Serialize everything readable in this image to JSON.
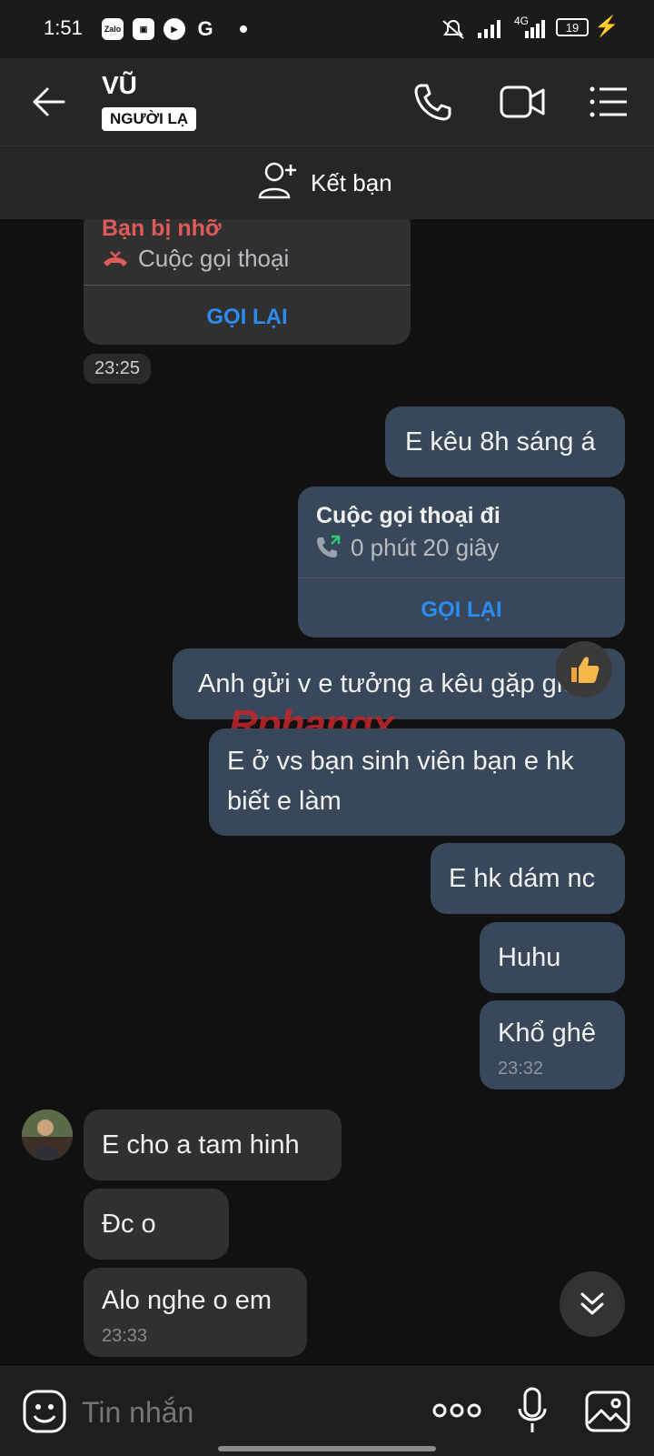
{
  "status_bar": {
    "time": "1:51",
    "app_icons": [
      "zalo-icon",
      "media-icon",
      "youtube-icon",
      "google-icon"
    ],
    "network": "4G",
    "battery": "19"
  },
  "header": {
    "name": "VŨ",
    "badge": "NGƯỜI LẠ"
  },
  "friend_bar": {
    "label": "Kết bạn"
  },
  "messages": {
    "missed_call": {
      "title": "Bạn bị nhỡ",
      "subtitle": "Cuộc gọi thoại",
      "action": "GỌI LẠI",
      "time": "23:25"
    },
    "out1": "E kêu 8h sáng á",
    "outgoing_call": {
      "title": "Cuộc gọi thoại đi",
      "duration": "0 phút 20 giây",
      "action": "GỌI LẠI"
    },
    "out2": "Anh gửi v e tưởng a kêu gặp giờ",
    "out3": "E ở vs bạn sinh viên bạn e hk biết e làm",
    "out4": "E hk dám nc",
    "out5": "Huhu",
    "out6": "Khổ ghê",
    "out6_time": "23:32",
    "in1": "E cho a tam hinh",
    "in2": "Đc o",
    "in3": "Alo nghe o em",
    "in3_time": "23:33"
  },
  "watermark": "Rphangx",
  "input": {
    "placeholder": "Tin nhắn"
  },
  "colors": {
    "background": "#111111",
    "outgoing_bubble": "#38485a",
    "incoming_bubble": "#303030",
    "link_blue": "#2d8cf0",
    "missed_red": "#e05a5a"
  }
}
